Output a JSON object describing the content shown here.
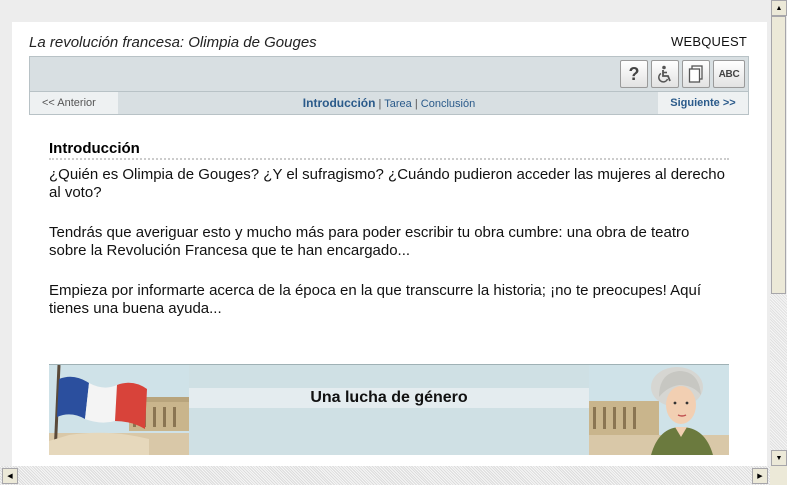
{
  "header": {
    "title": "La revolución francesa: Olimpia de Gouges",
    "badge": "WEBQUEST"
  },
  "toolbar": {
    "help_label": "?",
    "accessibility_icon": "wheelchair-icon",
    "clipboard_icon": "clipboard-icon",
    "abc_label": "ABC"
  },
  "nav": {
    "prev_label": "<<  Anterior",
    "current": "Introducción",
    "sep1": " | ",
    "link1": "Tarea",
    "sep2": " | ",
    "link2": "Conclusión",
    "next_label": "Siguiente >>"
  },
  "content": {
    "section_title": "Introducción",
    "paragraphs": [
      "¿Quién es Olimpia de Gouges? ¿Y el sufragismo? ¿Cuándo pudieron acceder las mujeres al derecho al voto?",
      "Tendrás que averiguar esto y mucho más para poder escribir tu obra cumbre: una obra de teatro sobre la Revolución Francesa que te han encargado...",
      "Empieza por informarte acerca de la época en la que transcurre la historia; ¡no te preocupes! Aquí tienes una buena ayuda..."
    ]
  },
  "banner": {
    "title": "Una lucha de género"
  },
  "colors": {
    "accent_blue": "#2a5a8a",
    "toolbar_bg": "#d8dfe2",
    "banner_bg": "#cfe0e4"
  }
}
